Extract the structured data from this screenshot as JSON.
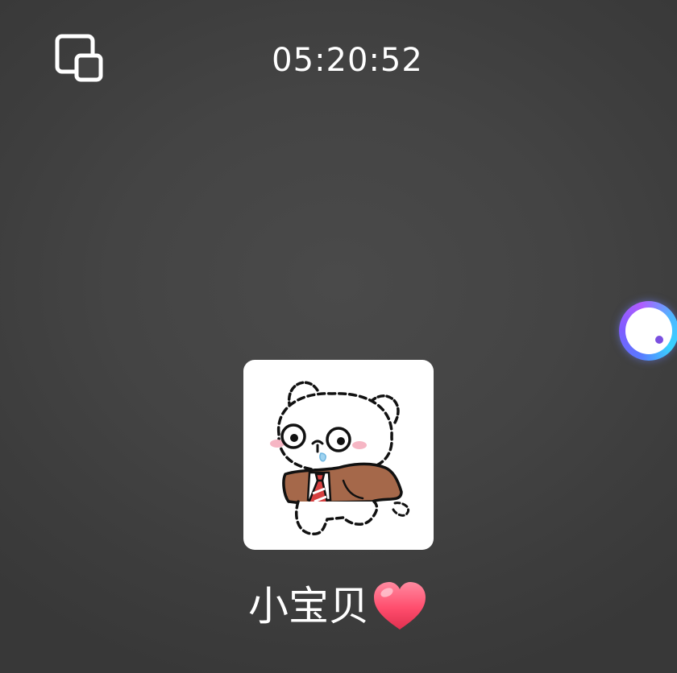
{
  "call": {
    "timer": "05:20:52"
  },
  "contact": {
    "name": "小宝贝",
    "name_suffix_icon": "heart-icon",
    "avatar_icon": "cartoon-bear-avatar"
  },
  "controls": {
    "float_window_icon": "float-window-icon",
    "assistant_icon": "assistant-ball-icon"
  },
  "colors": {
    "background": "#444444",
    "text": "#ffffff",
    "heart": "#ff4d6d",
    "assistant_ring": "#7d5cff"
  }
}
